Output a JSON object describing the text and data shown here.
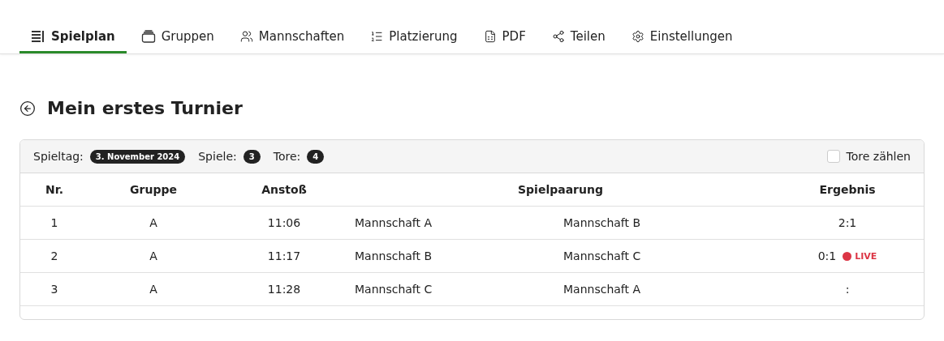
{
  "tabs": [
    {
      "label": "Spielplan",
      "selected": true
    },
    {
      "label": "Gruppen",
      "selected": false
    },
    {
      "label": "Mannschaften",
      "selected": false
    },
    {
      "label": "Platzierung",
      "selected": false
    },
    {
      "label": "PDF",
      "selected": false
    },
    {
      "label": "Teilen",
      "selected": false
    },
    {
      "label": "Einstellungen",
      "selected": false
    }
  ],
  "title": "Mein erstes Turnier",
  "summary": {
    "matchday_label": "Spieltag:",
    "matchday": "3. November 2024",
    "games_label": "Spiele:",
    "games": "3",
    "goals_label": "Tore:",
    "goals": "4",
    "count_goals": {
      "label": "Tore zählen",
      "checked": false
    }
  },
  "table": {
    "columns": [
      "Nr.",
      "Gruppe",
      "Anstoß",
      "Spielpaarung",
      "Ergebnis"
    ],
    "rows": [
      {
        "nr": "1",
        "group": "A",
        "kickoff": "11:06",
        "home": "Mannschaft A",
        "away": "Mannschaft B",
        "result": "2:1",
        "live": false
      },
      {
        "nr": "2",
        "group": "A",
        "kickoff": "11:17",
        "home": "Mannschaft B",
        "away": "Mannschaft C",
        "result": "0:1",
        "live": true,
        "live_label": "LIVE"
      },
      {
        "nr": "3",
        "group": "A",
        "kickoff": "11:28",
        "home": "Mannschaft C",
        "away": "Mannschaft A",
        "result": ":",
        "live": false
      }
    ]
  }
}
